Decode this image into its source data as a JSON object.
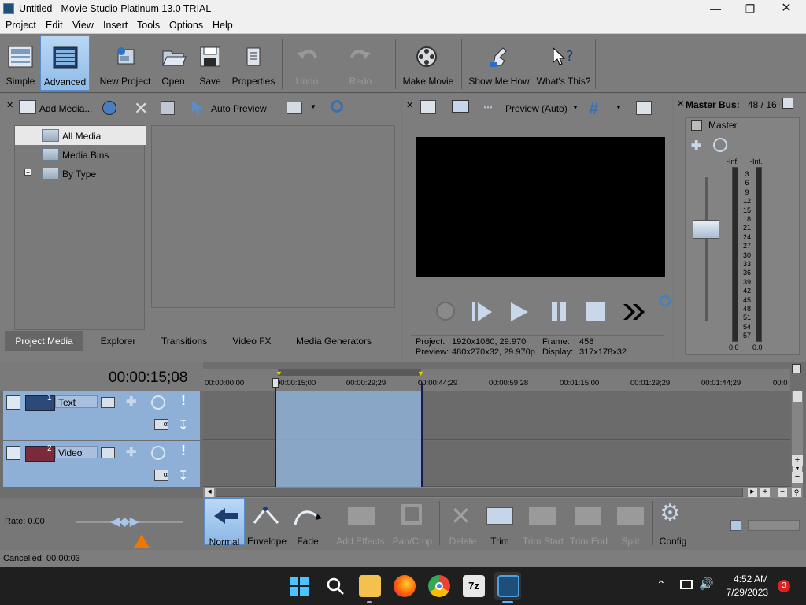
{
  "window": {
    "title": "Untitled - Movie Studio Platinum 13.0 TRIAL"
  },
  "menu": [
    "Project",
    "Edit",
    "View",
    "Insert",
    "Tools",
    "Options",
    "Help"
  ],
  "toolbar": {
    "simple": "Simple",
    "advanced": "Advanced",
    "new_project": "New Project",
    "open": "Open",
    "save": "Save",
    "properties": "Properties",
    "undo": "Undo",
    "redo": "Redo",
    "make_movie": "Make Movie",
    "show_me_how": "Show Me How",
    "whats_this": "What's This?"
  },
  "media_panel": {
    "add_media": "Add Media...",
    "auto_preview": "Auto Preview",
    "tree": [
      "All Media",
      "Media Bins",
      "By Type"
    ],
    "tabs": [
      "Project Media",
      "Explorer",
      "Transitions",
      "Video FX",
      "Media Generators"
    ]
  },
  "preview": {
    "mode": "Preview (Auto)",
    "project_label": "Project:",
    "project_value": "1920x1080, 29.970i",
    "frame_label": "Frame:",
    "frame_value": "458",
    "preview_label": "Preview:",
    "preview_value": "480x270x32, 29.970p",
    "display_label": "Display:",
    "display_value": "317x178x32"
  },
  "master": {
    "title": "Master Bus:",
    "ratio": "48 / 16",
    "name": "Master",
    "inf_left": "-Inf.",
    "inf_right": "-Inf.",
    "scale": [
      "3",
      "6",
      "9",
      "12",
      "15",
      "18",
      "21",
      "24",
      "27",
      "30",
      "33",
      "36",
      "39",
      "42",
      "45",
      "48",
      "51",
      "54",
      "57"
    ],
    "bottom_left": "0.0",
    "bottom_right": "0.0"
  },
  "timeline": {
    "time": "00:00:15;08",
    "ruler": [
      "00:00:00;00",
      "00:00:15;00",
      "00:00:29;29",
      "00:00:44;29",
      "00:00:59;28",
      "00:01:15;00",
      "00:01:29;29",
      "00:01:44;29",
      "00:0"
    ],
    "tracks": [
      {
        "num": "1",
        "name": "Text"
      },
      {
        "num": "2",
        "name": "Video"
      }
    ]
  },
  "bottom": {
    "rate": "Rate: 0.00",
    "status": "Cancelled: 00:00:03",
    "tools": {
      "normal": "Normal",
      "envelope": "Envelope",
      "fade": "Fade",
      "add_effects": "Add Effects",
      "pan_crop": "Pan/Crop",
      "delete": "Delete",
      "trim": "Trim",
      "trim_start": "Trim Start",
      "trim_end": "Trim End",
      "split": "Split",
      "config": "Config"
    }
  },
  "taskbar": {
    "time": "4:52 AM",
    "date": "7/29/2023",
    "badge": "3"
  }
}
